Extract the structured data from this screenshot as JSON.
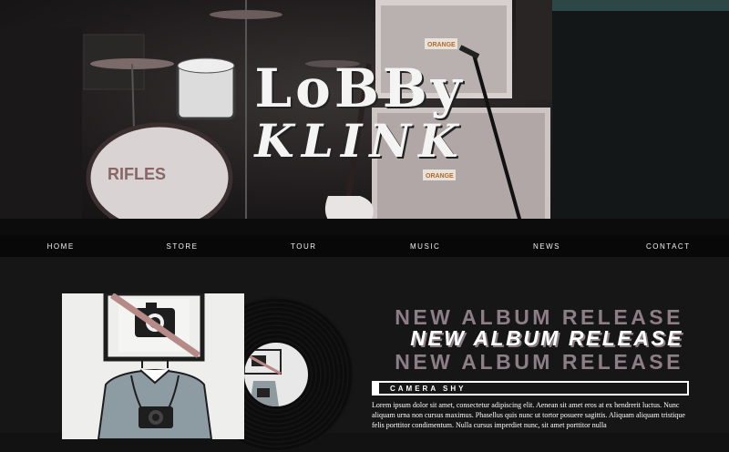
{
  "brand": {
    "logo_line1": "LoBBy",
    "logo_line2": "KLINK"
  },
  "hero": {
    "drum_text": "RIFLES",
    "amp_text": "ORANGE"
  },
  "nav": {
    "items": [
      "HOME",
      "STORE",
      "TOUR",
      "MUSIC",
      "NEWS",
      "CONTACT"
    ]
  },
  "album": {
    "headline": "NEW ALBUM RELEASE",
    "title": "CAMERA SHY",
    "body": "Lorem ipsum dolor sit amet, consectetur adipiscing elit. Aenean sit amet eros at ex hendrerit luctus. Nunc aliquam urna non cursus maximus. Phasellus quis nunc ut tortor posuere sagittis. Aliquam aliquam tristique felis porttitor condimentum. Nulla cursus imperdiet nunc, sit amet porttitor nulla"
  },
  "colors": {
    "background": "#161616",
    "nav_background": "#080808",
    "accent": "#8d7e86",
    "text": "#ffffff"
  }
}
